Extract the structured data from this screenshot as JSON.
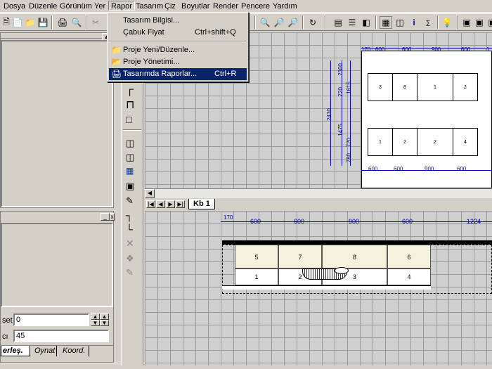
{
  "menubar": {
    "items": [
      {
        "label": "Dosya"
      },
      {
        "label": "Düzenle"
      },
      {
        "label": "Görünüm"
      },
      {
        "label": "Yer"
      },
      {
        "label": "Rapor"
      },
      {
        "label": "Tasarım"
      },
      {
        "label": "Çiz"
      },
      {
        "label": "Boyutlar"
      },
      {
        "label": "Render"
      },
      {
        "label": "Pencere"
      },
      {
        "label": "Yardım"
      }
    ]
  },
  "rapor_menu": {
    "items": [
      {
        "label": "Tasarım Bilgisi...",
        "shortcut": ""
      },
      {
        "label": "Çabuk Fiyat",
        "shortcut": "Ctrl+shift+Q"
      },
      {
        "label": "Proje Yeni/Düzenle...",
        "shortcut": ""
      },
      {
        "label": "Proje Yönetimi...",
        "shortcut": ""
      },
      {
        "label": "Tasarımda Raporlar...",
        "shortcut": "Ctrl+R"
      }
    ]
  },
  "properties_panel": {
    "offset_label": "set",
    "offset_value": "0",
    "angle_label": "cı",
    "angle_value": "45"
  },
  "left_tabs": [
    {
      "label": "erleş."
    },
    {
      "label": "Oynat"
    },
    {
      "label": "Koord."
    }
  ],
  "view_tab": {
    "label": "Kb 1"
  },
  "top_view": {
    "dim_top": [
      "170",
      "600",
      "600",
      "900",
      "600",
      "1"
    ],
    "dim_left": [
      "2300",
      "1615",
      "720",
      "720",
      "2430",
      "1475",
      "780"
    ],
    "upper_cabinets": [
      "3",
      "8",
      "1",
      "2"
    ],
    "lower_cabinets": [
      "1",
      "2",
      "2",
      "4"
    ]
  },
  "front_view": {
    "dims": [
      "170",
      "600",
      "600",
      "900",
      "600",
      "1224"
    ],
    "upper_labels": [
      "5",
      "7",
      "8",
      "6"
    ],
    "lower_labels": [
      "1",
      "2",
      "3",
      "4"
    ]
  },
  "icons": {
    "toolbar": [
      "new-icon",
      "new-doc-icon",
      "open-icon",
      "save-icon",
      "print-icon",
      "print-preview-icon",
      "cut-icon",
      "zoom-icon",
      "zoom-in-icon",
      "zoom-out-icon",
      "refresh-icon",
      "view-icon",
      "list-icon",
      "panel-icon",
      "grid-icon",
      "box-icon",
      "info-icon",
      "calc-icon",
      "bulb-icon",
      "cube-icon",
      "cube2-icon",
      "cube3-icon"
    ]
  }
}
